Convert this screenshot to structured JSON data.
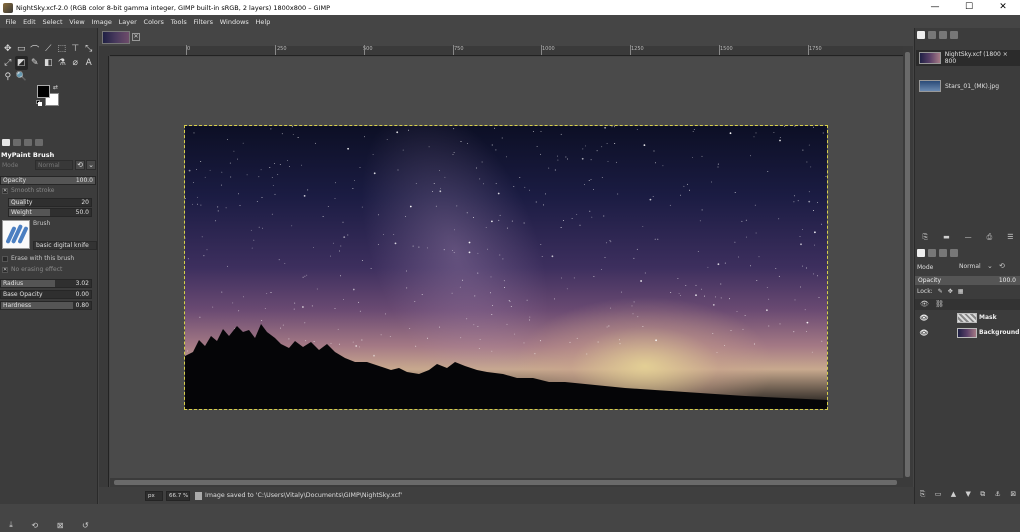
{
  "window": {
    "title": "NightSky.xcf-2.0 (RGB color 8-bit gamma integer, GIMP built-in sRGB, 2 layers) 1800x800 – GIMP",
    "controls": [
      "—",
      "☐",
      "✕"
    ]
  },
  "menu": [
    "File",
    "Edit",
    "Select",
    "View",
    "Image",
    "Layer",
    "Colors",
    "Tools",
    "Filters",
    "Windows",
    "Help"
  ],
  "toolbox": {
    "tools": [
      "✥",
      "▭",
      "⌒",
      "⟋",
      "⬚",
      "⊤",
      "⤡",
      "⤢",
      "◩",
      "✎",
      "◧",
      "⚗",
      "⌀",
      "A",
      "⚲",
      "🔍"
    ],
    "colors": {
      "foreground": "#000000",
      "background": "#ffffff"
    }
  },
  "tool_options": {
    "title": "MyPaint Brush",
    "mode_label": "Mode",
    "mode_value": "Normal",
    "opacity": {
      "label": "Opacity",
      "value": "100.0"
    },
    "smooth_stroke": "Smooth stroke",
    "quality": {
      "label": "Quality",
      "value": "20"
    },
    "weight": {
      "label": "Weight",
      "value": "50.0"
    },
    "brush_label": "Brush",
    "brush_name": "basic digital knife",
    "erase": "Erase with this brush",
    "no_erasing": "No erasing effect",
    "radius": {
      "label": "Radius",
      "value": "3.02"
    },
    "base_opacity": {
      "label": "Base Opacity",
      "value": "0.00"
    },
    "hardness": {
      "label": "Hardness",
      "value": "0.80"
    }
  },
  "rulers": {
    "top": [
      "0",
      "250",
      "500",
      "750",
      "1000",
      "1250",
      "1500",
      "1750"
    ]
  },
  "statusbar": {
    "unit": "px",
    "zoom": "66.7 %",
    "message": "Image saved to 'C:\\Users\\Vitaly\\Documents\\GIMP\\NightSky.xcf'"
  },
  "images_panel": {
    "items": [
      {
        "name": "NightSky.xcf (1800 × 800",
        "selected": true
      },
      {
        "name": "Stars_01_(MK).jpg",
        "selected": false
      }
    ]
  },
  "layers_panel": {
    "mode_label": "Mode",
    "mode_value": "Normal",
    "opacity_label": "Opacity",
    "opacity_value": "100.0",
    "lock_label": "Lock:",
    "layers": [
      {
        "name": "Mask",
        "visible": true
      },
      {
        "name": "Background",
        "visible": true
      }
    ]
  }
}
